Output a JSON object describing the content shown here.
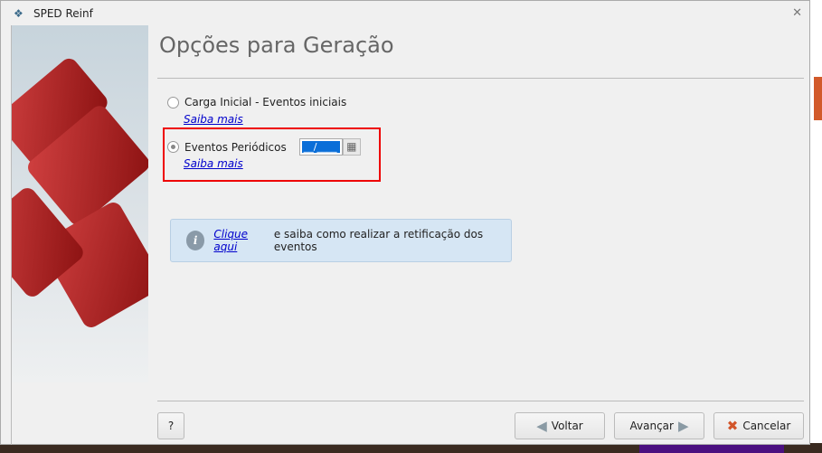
{
  "window": {
    "title": "SPED Reinf"
  },
  "page": {
    "title": "Opções para Geração"
  },
  "options": [
    {
      "label": "Carga Inicial - Eventos iniciais",
      "link": "Saiba mais",
      "selected": false
    },
    {
      "label": "Eventos Periódicos",
      "link": "Saiba mais",
      "selected": true,
      "date_value": "__/____"
    }
  ],
  "info": {
    "link": "Clique aqui",
    "text": "e saiba como realizar a retificação dos eventos"
  },
  "buttons": {
    "help": "?",
    "back": "Voltar",
    "next": "Avançar",
    "cancel": "Cancelar"
  }
}
